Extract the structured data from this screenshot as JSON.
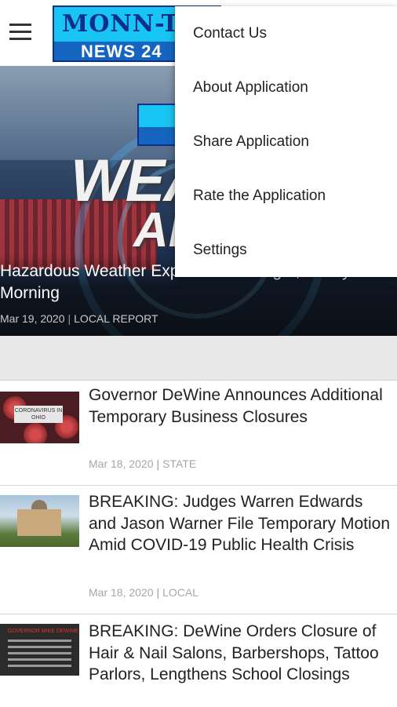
{
  "app": {
    "logo_top": "MONN-TV",
    "logo_bottom": "NEWS 24"
  },
  "featured": {
    "banner_word1": "WEATHER",
    "banner_word2": "ALERT",
    "mini_logo": "MONN",
    "title_line1": "Hazardous Weather Expected Overnight, Friday",
    "title_line2": "Morning",
    "date": "Mar 19, 2020",
    "category": "LOCAL REPORT"
  },
  "articles": [
    {
      "title": "Governor DeWine Announces Additional Temporary Business Closures",
      "date": "Mar 18, 2020",
      "category": "STATE",
      "thumb_label": "CORONAVIRUS IN OHIO"
    },
    {
      "title": "BREAKING: Judges Warren Edwards and Jason Warner File Temporary Motion Amid COVID-19 Public Health Crisis",
      "date": "Mar 18, 2020",
      "category": "LOCAL"
    },
    {
      "title": "BREAKING: DeWine Orders Closure of Hair & Nail Salons, Barbershops, Tattoo Parlors, Lengthens School Closings",
      "thumb_label": "GOVERNOR MIKE DEWINE"
    }
  ],
  "menu": {
    "items": [
      {
        "label": "Contact Us"
      },
      {
        "label": "About Application"
      },
      {
        "label": "Share Application"
      },
      {
        "label": "Rate the Application"
      },
      {
        "label": "Settings"
      }
    ]
  },
  "icons": {
    "menu": "hamburger-menu-icon"
  },
  "colors": {
    "logo_blue": "#1565c0",
    "logo_cyan": "#18c4f2",
    "meta_gray": "#a7a7a7"
  }
}
